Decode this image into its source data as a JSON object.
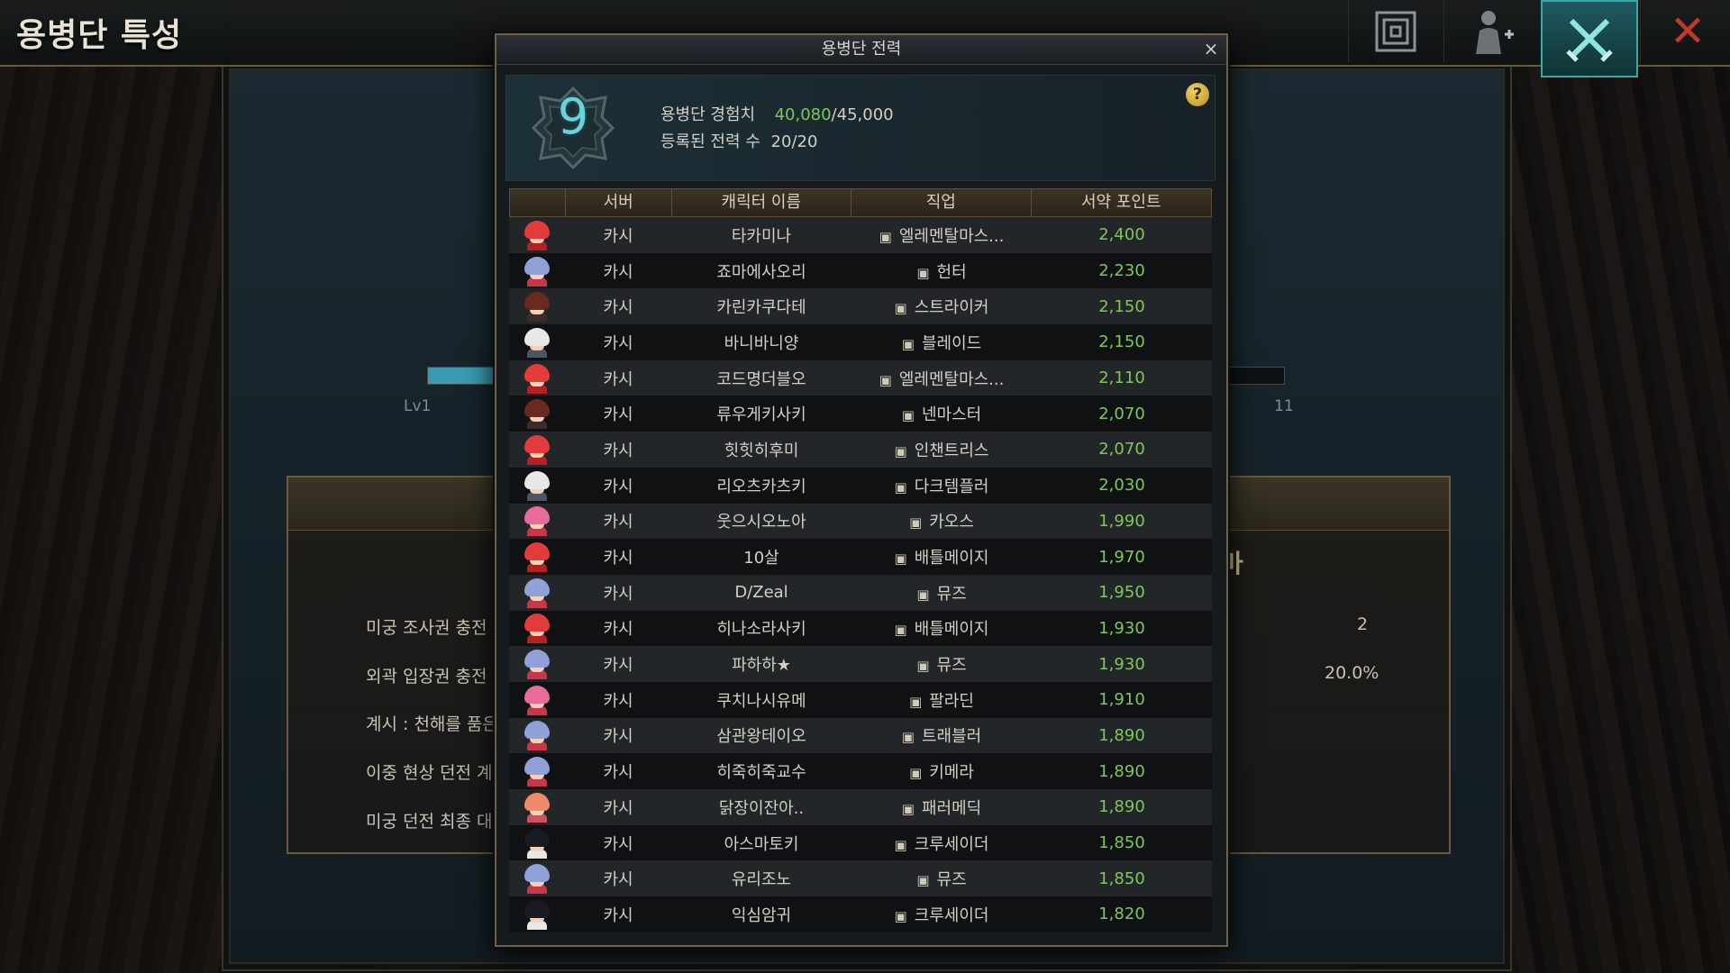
{
  "screen": {
    "title": "용병단 특성",
    "close_label": "✕"
  },
  "background": {
    "progress_fraction": 0.08,
    "level_left": "Lv1",
    "level_right": "11",
    "heading_fragment": "마",
    "rows": [
      {
        "label": "미궁 조사권 충전"
      },
      {
        "label": "외곽 입장권 충전"
      },
      {
        "label": "계시 : 천해를 품은"
      },
      {
        "label": "이중 현상 던전 계"
      },
      {
        "label": "미궁 던전 최종 대"
      }
    ],
    "right_values": [
      "2",
      "20.0%"
    ]
  },
  "popup": {
    "title": "용병단 전력",
    "close": "×",
    "level": "9",
    "exp_label": "용병단 경험치",
    "exp_current": "40,080",
    "exp_max": "/45,000",
    "registered_label": "등록된 전력 수",
    "registered_value": "20/20",
    "help": "?"
  },
  "table": {
    "headers": [
      "서버",
      "캐릭터 이름",
      "직업",
      "서약 포인트"
    ],
    "rows": [
      {
        "server": "카시",
        "name": "타카미나",
        "job": "엘레멘탈마스...",
        "points": "2,400",
        "hair": "#e33b3b",
        "body": "#b72020"
      },
      {
        "server": "카시",
        "name": "죠마에사오리",
        "job": "헌터",
        "points": "2,230",
        "hair": "#8fa1d6",
        "body": "#c9364c"
      },
      {
        "server": "카시",
        "name": "카린카쿠다테",
        "job": "스트라이커",
        "points": "2,150",
        "hair": "#6a2a22",
        "body": "#3d2b2b"
      },
      {
        "server": "카시",
        "name": "바니바니양",
        "job": "블레이드",
        "points": "2,150",
        "hair": "#e8e8e8",
        "body": "#4b5566"
      },
      {
        "server": "카시",
        "name": "코드명더블오",
        "job": "엘레멘탈마스...",
        "points": "2,110",
        "hair": "#e33b3b",
        "body": "#b72020"
      },
      {
        "server": "카시",
        "name": "류우게키사키",
        "job": "넨마스터",
        "points": "2,070",
        "hair": "#6a2a22",
        "body": "#3d2b2b"
      },
      {
        "server": "카시",
        "name": "힛힛히후미",
        "job": "인챈트리스",
        "points": "2,070",
        "hair": "#e33b3b",
        "body": "#b72020"
      },
      {
        "server": "카시",
        "name": "리오츠카츠키",
        "job": "다크템플러",
        "points": "2,030",
        "hair": "#e8e8e8",
        "body": "#4b5566"
      },
      {
        "server": "카시",
        "name": "웃으시오노아",
        "job": "카오스",
        "points": "1,990",
        "hair": "#e86c9a",
        "body": "#c9364c"
      },
      {
        "server": "카시",
        "name": "10살",
        "job": "배틀메이지",
        "points": "1,970",
        "hair": "#e33b3b",
        "body": "#b72020"
      },
      {
        "server": "카시",
        "name": "D/Zeal",
        "job": "뮤즈",
        "points": "1,950",
        "hair": "#8fa1d6",
        "body": "#c9364c"
      },
      {
        "server": "카시",
        "name": "히나소라사키",
        "job": "배틀메이지",
        "points": "1,930",
        "hair": "#e33b3b",
        "body": "#b72020"
      },
      {
        "server": "카시",
        "name": "파하하★",
        "job": "뮤즈",
        "points": "1,930",
        "hair": "#8fa1d6",
        "body": "#c9364c"
      },
      {
        "server": "카시",
        "name": "쿠치나시유메",
        "job": "팔라딘",
        "points": "1,910",
        "hair": "#e86c9a",
        "body": "#c9364c"
      },
      {
        "server": "카시",
        "name": "삼관왕테이오",
        "job": "트래블러",
        "points": "1,890",
        "hair": "#8fa1d6",
        "body": "#c9364c"
      },
      {
        "server": "카시",
        "name": "히죽히죽교수",
        "job": "키메라",
        "points": "1,890",
        "hair": "#8fa1d6",
        "body": "#c9364c"
      },
      {
        "server": "카시",
        "name": "닭장이잔아..",
        "job": "패러메딕",
        "points": "1,890",
        "hair": "#f08a6a",
        "body": "#d05060"
      },
      {
        "server": "카시",
        "name": "아스마토키",
        "job": "크루세이더",
        "points": "1,850",
        "hair": "#1a1a22",
        "body": "#e8e8e8"
      },
      {
        "server": "카시",
        "name": "유리조노",
        "job": "뮤즈",
        "points": "1,850",
        "hair": "#8fa1d6",
        "body": "#c9364c"
      },
      {
        "server": "카시",
        "name": "익심암귀",
        "job": "크루세이더",
        "points": "1,820",
        "hair": "#1a1a22",
        "body": "#e8e8e8"
      }
    ]
  },
  "colors": {
    "accent_teal": "#3aa8a8",
    "points_green": "#7ec85a",
    "exp_green": "#7ec85a",
    "frame_gold": "#6f6148",
    "close_red": "#c0392b"
  },
  "icons": {
    "top_1": "dungeon-map-icon",
    "top_2": "character-add-icon",
    "top_3": "crossed-swords-icon",
    "top_4": "close-icon",
    "class": "class-emblem-icon"
  }
}
